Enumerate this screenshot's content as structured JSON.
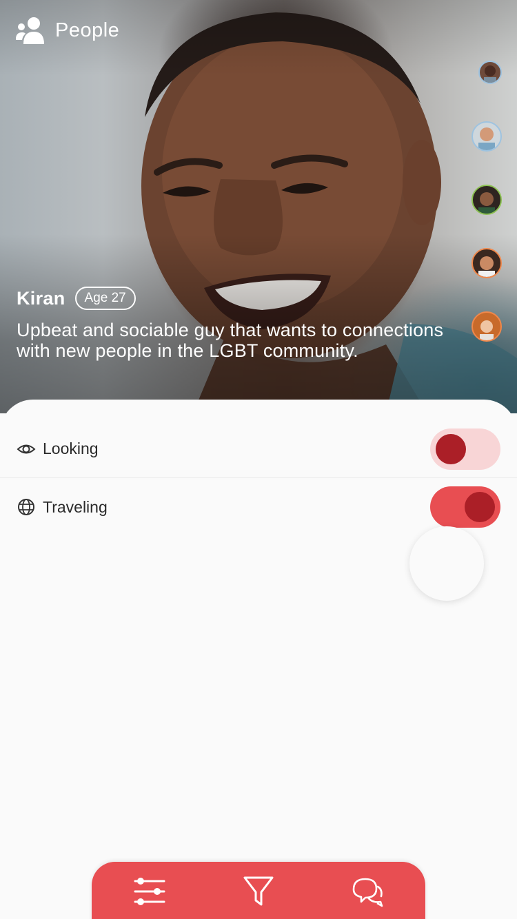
{
  "header": {
    "title": "People",
    "icon": "people-icon"
  },
  "profile": {
    "name": "Kiran",
    "age_badge": "Age 27",
    "bio": "Upbeat and sociable guy that wants to connections with new people in the LGBT community."
  },
  "avatars": [
    {
      "name": "avatar-1",
      "ring_color": "#9ec3e0"
    },
    {
      "name": "avatar-2",
      "ring_color": "#9ec3e0"
    },
    {
      "name": "avatar-3",
      "ring_color": "#8cc152"
    },
    {
      "name": "avatar-4",
      "ring_color": "#f0884b"
    },
    {
      "name": "avatar-5",
      "ring_color": "#f0884b"
    }
  ],
  "settings": [
    {
      "label": "Looking",
      "icon": "eye-icon",
      "enabled": false
    },
    {
      "label": "Traveling",
      "icon": "globe-icon",
      "enabled": true
    }
  ],
  "bottom_bar": {
    "buttons": [
      "sliders-icon",
      "filter-icon",
      "chat-icon"
    ]
  },
  "colors": {
    "accent": "#e84e52",
    "knob": "#ab1f27",
    "toggle_off_bg": "#f8d5d6"
  }
}
